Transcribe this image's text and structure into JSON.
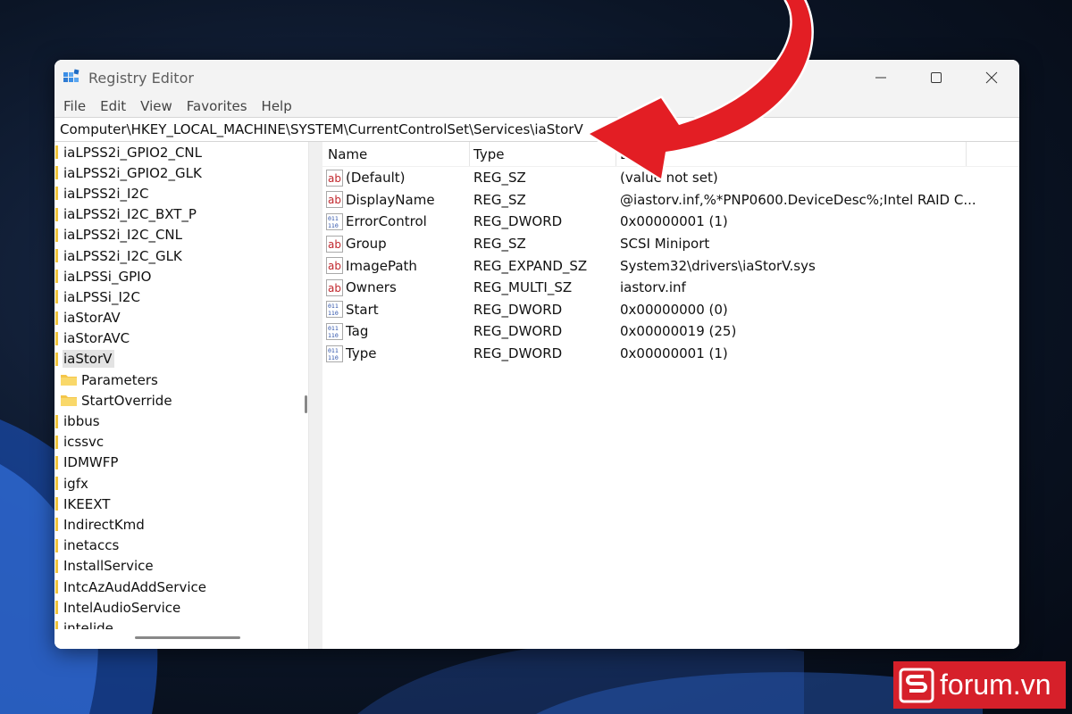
{
  "window": {
    "title": "Registry Editor",
    "minimize_icon": "minimize-icon",
    "maximize_icon": "maximize-icon",
    "close_icon": "close-icon"
  },
  "menu": [
    "File",
    "Edit",
    "View",
    "Favorites",
    "Help"
  ],
  "address": "Computer\\HKEY_LOCAL_MACHINE\\SYSTEM\\CurrentControlSet\\Services\\iaStorV",
  "tree": {
    "items": [
      {
        "label": "iaLPSS2i_GPIO2_CNL"
      },
      {
        "label": "iaLPSS2i_GPIO2_GLK"
      },
      {
        "label": "iaLPSS2i_I2C"
      },
      {
        "label": "iaLPSS2i_I2C_BXT_P"
      },
      {
        "label": "iaLPSS2i_I2C_CNL"
      },
      {
        "label": "iaLPSS2i_I2C_GLK"
      },
      {
        "label": "iaLPSSi_GPIO"
      },
      {
        "label": "iaLPSSi_I2C"
      },
      {
        "label": "iaStorAV"
      },
      {
        "label": "iaStorAVC"
      },
      {
        "label": "iaStorV"
      },
      {
        "label": "Parameters"
      },
      {
        "label": "StartOverride"
      },
      {
        "label": "ibbus"
      },
      {
        "label": "icssvc"
      },
      {
        "label": "IDMWFP"
      },
      {
        "label": "igfx"
      },
      {
        "label": "IKEEXT"
      },
      {
        "label": "IndirectKmd"
      },
      {
        "label": "inetaccs"
      },
      {
        "label": "InstallService"
      },
      {
        "label": "IntcAzAudAddService"
      },
      {
        "label": "IntelAudioService"
      },
      {
        "label": "intelide"
      }
    ],
    "selected": "iaStorV"
  },
  "columns": {
    "name": "Name",
    "type": "Type",
    "data": "Data"
  },
  "values": [
    {
      "name": "(Default)",
      "type": "REG_SZ",
      "data": "(value not set)",
      "icon": "string-value-icon"
    },
    {
      "name": "DisplayName",
      "type": "REG_SZ",
      "data": "@iastorv.inf,%*PNP0600.DeviceDesc%;Intel RAID C...",
      "icon": "string-value-icon"
    },
    {
      "name": "ErrorControl",
      "type": "REG_DWORD",
      "data": "0x00000001 (1)",
      "icon": "binary-value-icon"
    },
    {
      "name": "Group",
      "type": "REG_SZ",
      "data": "SCSI Miniport",
      "icon": "string-value-icon"
    },
    {
      "name": "ImagePath",
      "type": "REG_EXPAND_SZ",
      "data": "System32\\drivers\\iaStorV.sys",
      "icon": "string-value-icon"
    },
    {
      "name": "Owners",
      "type": "REG_MULTI_SZ",
      "data": "iastorv.inf",
      "icon": "string-value-icon"
    },
    {
      "name": "Start",
      "type": "REG_DWORD",
      "data": "0x00000000 (0)",
      "icon": "binary-value-icon"
    },
    {
      "name": "Tag",
      "type": "REG_DWORD",
      "data": "0x00000019 (25)",
      "icon": "binary-value-icon"
    },
    {
      "name": "Type",
      "type": "REG_DWORD",
      "data": "0x00000001 (1)",
      "icon": "binary-value-icon"
    }
  ],
  "brand": {
    "text": "forum.vn",
    "color": "#d6202a"
  },
  "arrow_color": "#e31e24"
}
